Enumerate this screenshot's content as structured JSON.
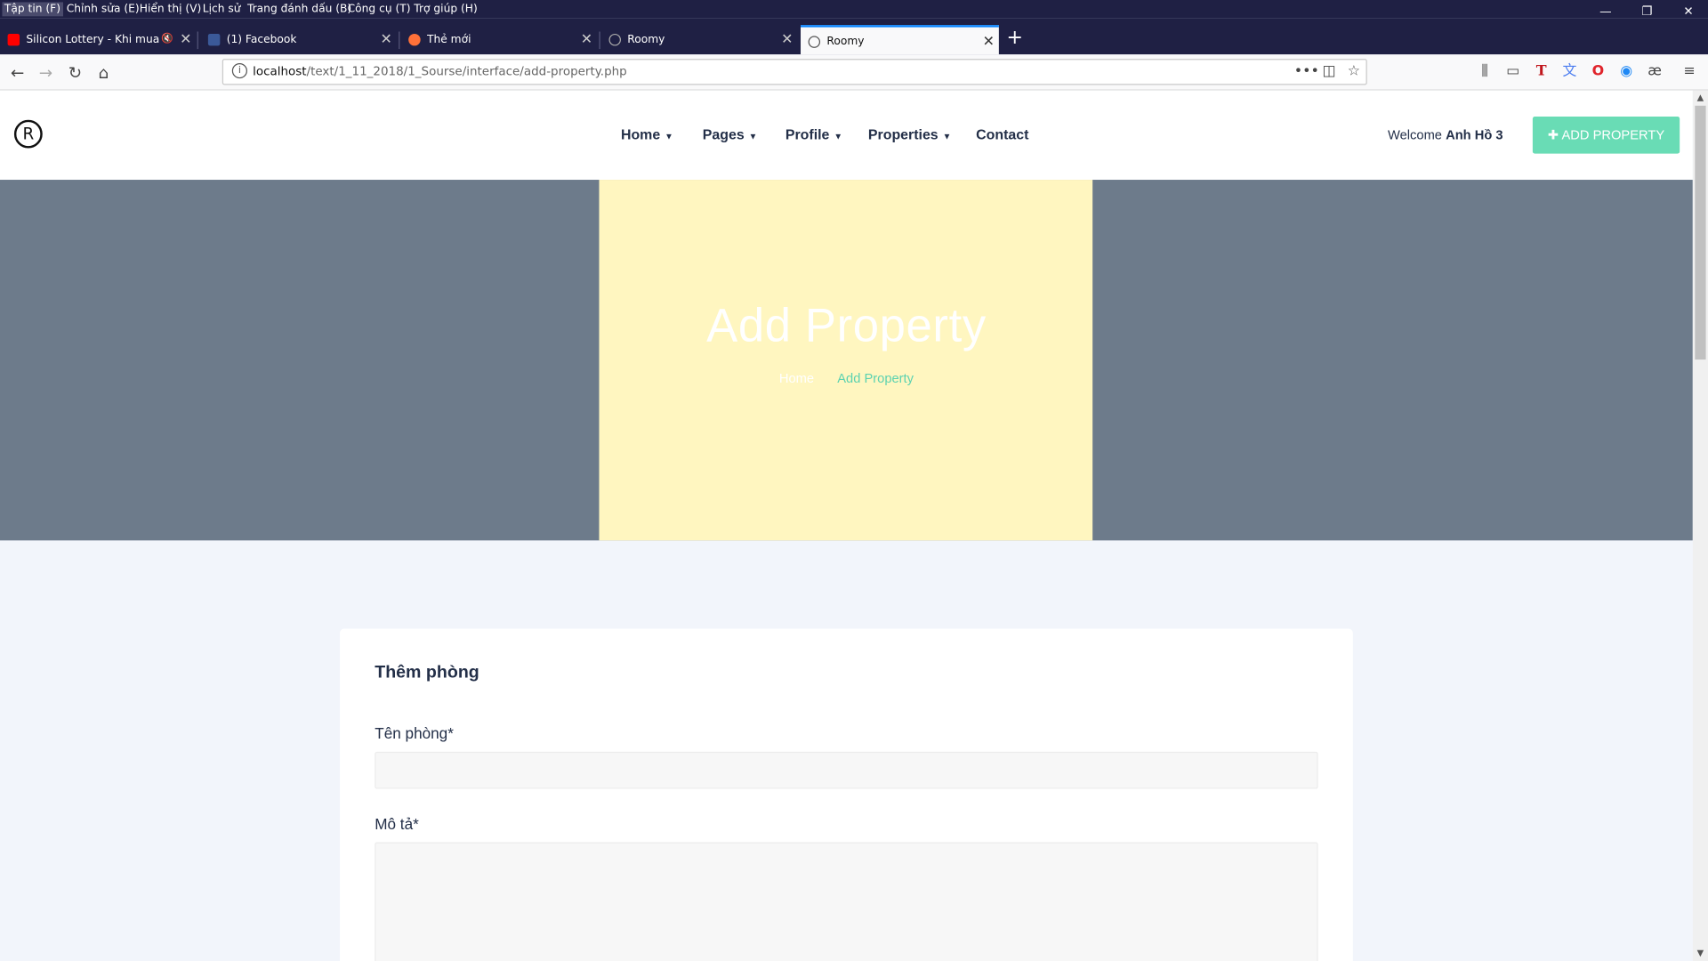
{
  "browser": {
    "menu": [
      "Tập tin (F)",
      "Chỉnh sửa (E)",
      "Hiển thị (V)",
      "Lịch sử",
      "Trang đánh dấu (B)",
      "Công cụ (T)",
      "Trợ giúp (H)"
    ],
    "window_controls": {
      "minimize": "—",
      "restore": "❐",
      "close": "✕"
    },
    "tabs": [
      {
        "label": "Silicon Lottery - Khi mua m",
        "icon": "youtube-icon",
        "icon_color": "#ff0000",
        "muted_icon": "🔇"
      },
      {
        "label": "(1) Facebook",
        "icon": "facebook-icon",
        "icon_color": "#3b5998"
      },
      {
        "label": "Thẻ mới",
        "icon": "firefox-icon",
        "icon_color": "#ff7139"
      },
      {
        "label": "Roomy",
        "icon": "roomy-icon"
      },
      {
        "label": "Roomy",
        "icon": "roomy-icon",
        "active": true
      }
    ],
    "tab_close": "✕",
    "new_tab": "+",
    "address": {
      "host": "localhost",
      "path": "/text/1_11_2018/1_Sourse/interface/add-property.php"
    }
  },
  "site": {
    "logo": "R",
    "nav": [
      {
        "label": "Home",
        "dropdown": true
      },
      {
        "label": "Pages",
        "dropdown": true
      },
      {
        "label": "Profile",
        "dropdown": true
      },
      {
        "label": "Properties",
        "dropdown": true
      },
      {
        "label": "Contact",
        "dropdown": false
      }
    ],
    "welcome_prefix": "Welcome",
    "welcome_user": "Anh Hồ 3",
    "add_button": "ADD PROPERTY",
    "hero": {
      "title": "Add Property",
      "crumb_home": "Home",
      "crumb_current": "Add Property"
    },
    "form": {
      "title": "Thêm phòng",
      "name_label": "Tên phòng*",
      "name_value": "",
      "desc_label": "Mô tả*",
      "desc_value": ""
    },
    "colors": {
      "accent": "#69dcb5",
      "hero_bg": "#6d7b8b",
      "hero_image": "#fff6c0",
      "text_dark": "#232f48"
    }
  }
}
